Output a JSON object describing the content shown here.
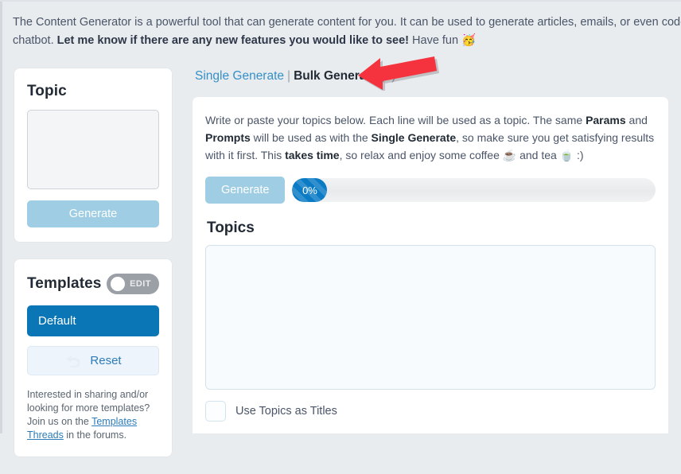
{
  "intro": {
    "line1": "The Content Generator is a powerful tool that can generate content for you. It can be used to generate articles, emails, or even code. It can also be",
    "line2_pre": "chatbot. ",
    "line2_bold": "Let me know if there are any new features you would like to see!",
    "line2_post": " Have fun 🥳"
  },
  "sidebar": {
    "topic": {
      "title": "Topic",
      "textarea_value": "",
      "textarea_placeholder": "",
      "generate_label": "Generate"
    },
    "templates": {
      "title": "Templates",
      "edit_toggle_label": "EDIT",
      "edit_toggle_state": "off",
      "default_label": "Default",
      "reset_label": "Reset",
      "reset_icon": "undo-icon",
      "help_pre": "Interested in sharing and/or looking for more templates? Join us on the ",
      "help_link": "Templates Threads",
      "help_post": " in the forums."
    }
  },
  "tabs": {
    "single_generate": "Single Generate",
    "separator": "|",
    "bulk_generate": "Bulk Generate",
    "bulk_count": "(0)"
  },
  "panel": {
    "desc_1": "Write or paste your topics below. Each line will be used as a topic. The same ",
    "desc_b1": "Params",
    "desc_2": " and ",
    "desc_b2": "Prompts",
    "desc_3": " will be used as with the ",
    "desc_b3": "Single Generate",
    "desc_4": ", so make sure you get satisfying results with it first. This ",
    "desc_b4": "takes time",
    "desc_5": ", so relax and enjoy some coffee ☕ and tea 🍵 :)",
    "generate_label": "Generate",
    "progress_text": "0%",
    "progress_percent": 0,
    "topics_title": "Topics",
    "topics_value": "",
    "topics_placeholder": "",
    "use_topics_as_titles_label": "Use Topics as Titles",
    "use_topics_as_titles_checked": false
  },
  "annotation": {
    "arrow_color": "#f5333f",
    "arrow_points_to": "Bulk Generate"
  },
  "colors": {
    "page_background": "#e9ecef",
    "card_background": "#ffffff",
    "primary_blue": "#0a76b5",
    "link_blue": "#3490c8",
    "disabled_button": "#9fcde4",
    "toggle_off": "#9aa0a6",
    "progress_blue": "#0a7bc4",
    "annotation_red": "#f5333f"
  }
}
